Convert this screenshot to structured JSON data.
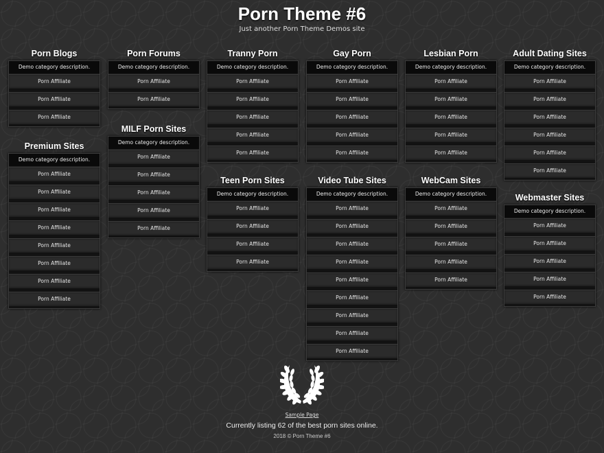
{
  "header": {
    "title": "Porn Theme #6",
    "tagline": "Just another Porn Theme Demos site"
  },
  "categories": [
    {
      "title": "Porn Blogs",
      "description": "Demo category description.",
      "items": [
        "Porn Affiliate",
        "Porn Affiliate",
        "Porn Affiliate"
      ]
    },
    {
      "title": "Premium Sites",
      "description": "Demo category description.",
      "items": [
        "Porn Affiliate",
        "Porn Affiliate",
        "Porn Affiliate",
        "Porn Affiliate",
        "Porn Affiliate",
        "Porn Affiliate",
        "Porn Affiliate",
        "Porn Affiliate"
      ]
    },
    {
      "title": "Porn Forums",
      "description": "Demo category description.",
      "items": [
        "Porn Affiliate",
        "Porn Affiliate"
      ]
    },
    {
      "title": "MILF Porn Sites",
      "description": "Demo category description.",
      "items": [
        "Porn Affiliate",
        "Porn Affiliate",
        "Porn Affiliate",
        "Porn Affiliate",
        "Porn Affiliate"
      ]
    },
    {
      "title": "Tranny Porn",
      "description": "Demo category description.",
      "items": [
        "Porn Affiliate",
        "Porn Affiliate",
        "Porn Affiliate",
        "Porn Affiliate",
        "Porn Affiliate"
      ]
    },
    {
      "title": "Teen Porn Sites",
      "description": "Demo category description.",
      "items": [
        "Porn Affiliate",
        "Porn Affiliate",
        "Porn Affiliate",
        "Porn Affiliate"
      ]
    },
    {
      "title": "Gay Porn",
      "description": "Demo category description.",
      "items": [
        "Porn Affiliate",
        "Porn Affiliate",
        "Porn Affiliate",
        "Porn Affiliate",
        "Porn Affiliate"
      ]
    },
    {
      "title": "Video Tube Sites",
      "description": "Demo category description.",
      "items": [
        "Porn Affiliate",
        "Porn Affiliate",
        "Porn Affiliate",
        "Porn Affiliate",
        "Porn Affiliate",
        "Porn Affiliate",
        "Porn Affiliate",
        "Porn Affiliate",
        "Porn Affiliate"
      ]
    },
    {
      "title": "Lesbian Porn",
      "description": "Demo category description.",
      "items": [
        "Porn Affiliate",
        "Porn Affiliate",
        "Porn Affiliate",
        "Porn Affiliate",
        "Porn Affiliate"
      ]
    },
    {
      "title": "WebCam Sites",
      "description": "Demo category description.",
      "items": [
        "Porn Affiliate",
        "Porn Affiliate",
        "Porn Affiliate",
        "Porn Affiliate",
        "Porn Affiliate"
      ]
    },
    {
      "title": "Adult Dating Sites",
      "description": "Demo category description.",
      "items": [
        "Porn Affiliate",
        "Porn Affiliate",
        "Porn Affiliate",
        "Porn Affiliate",
        "Porn Affiliate",
        "Porn Affiliate"
      ]
    },
    {
      "title": "Webmaster Sites",
      "description": "Demo category description.",
      "items": [
        "Porn Affiliate",
        "Porn Affiliate",
        "Porn Affiliate",
        "Porn Affiliate",
        "Porn Affiliate"
      ]
    }
  ],
  "footer": {
    "logo_icon": "laurel-wreath-icon",
    "link_label": "Sample Page",
    "listing_text": "Currently listing 62 of the best porn sites online.",
    "copyright": "2018 © Porn Theme #6"
  }
}
